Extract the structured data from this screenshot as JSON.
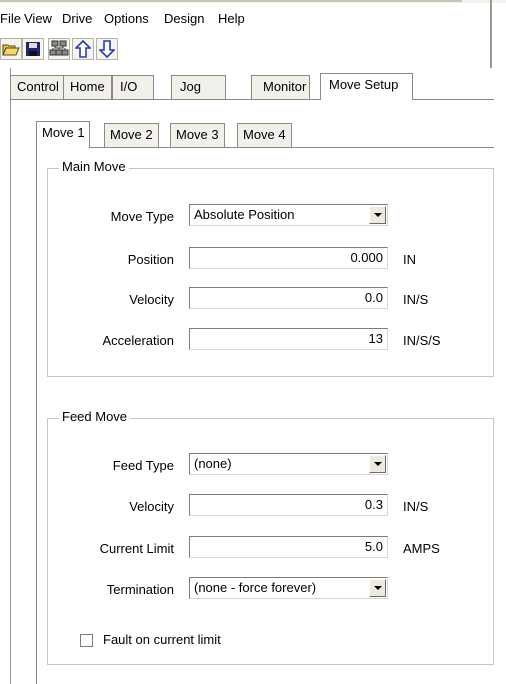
{
  "menu": [
    "File",
    "View",
    "Drive",
    "Options",
    "Design",
    "Help"
  ],
  "toolbar": {
    "buttons": [
      "open-folder-icon",
      "save-disk-icon",
      "drives-network-icon",
      "upload-arrow-icon",
      "download-arrow-icon"
    ]
  },
  "outer_tabs": [
    "Control",
    "Home",
    "I/O",
    "Jog",
    "Monitor",
    "Move Setup"
  ],
  "inner_tabs": [
    "Move 1",
    "Move 2",
    "Move 3",
    "Move 4"
  ],
  "main_move": {
    "title": "Main Move",
    "move_type_label": "Move Type",
    "move_type_value": "Absolute Position",
    "position_label": "Position",
    "position_value": "0.000",
    "position_unit": "IN",
    "velocity_label": "Velocity",
    "velocity_value": "0.0",
    "velocity_unit": "IN/S",
    "acceleration_label": "Acceleration",
    "acceleration_value": "13",
    "acceleration_unit": "IN/S/S"
  },
  "feed_move": {
    "title": "Feed Move",
    "feed_type_label": "Feed Type",
    "feed_type_value": "(none)",
    "velocity_label": "Velocity",
    "velocity_value": "0.3",
    "velocity_unit": "IN/S",
    "current_limit_label": "Current Limit",
    "current_limit_value": "5.0",
    "current_limit_unit": "AMPS",
    "termination_label": "Termination",
    "termination_value": "(none - force forever)"
  },
  "fault_checkbox": {
    "label": "Fault on current limit",
    "checked": false
  }
}
